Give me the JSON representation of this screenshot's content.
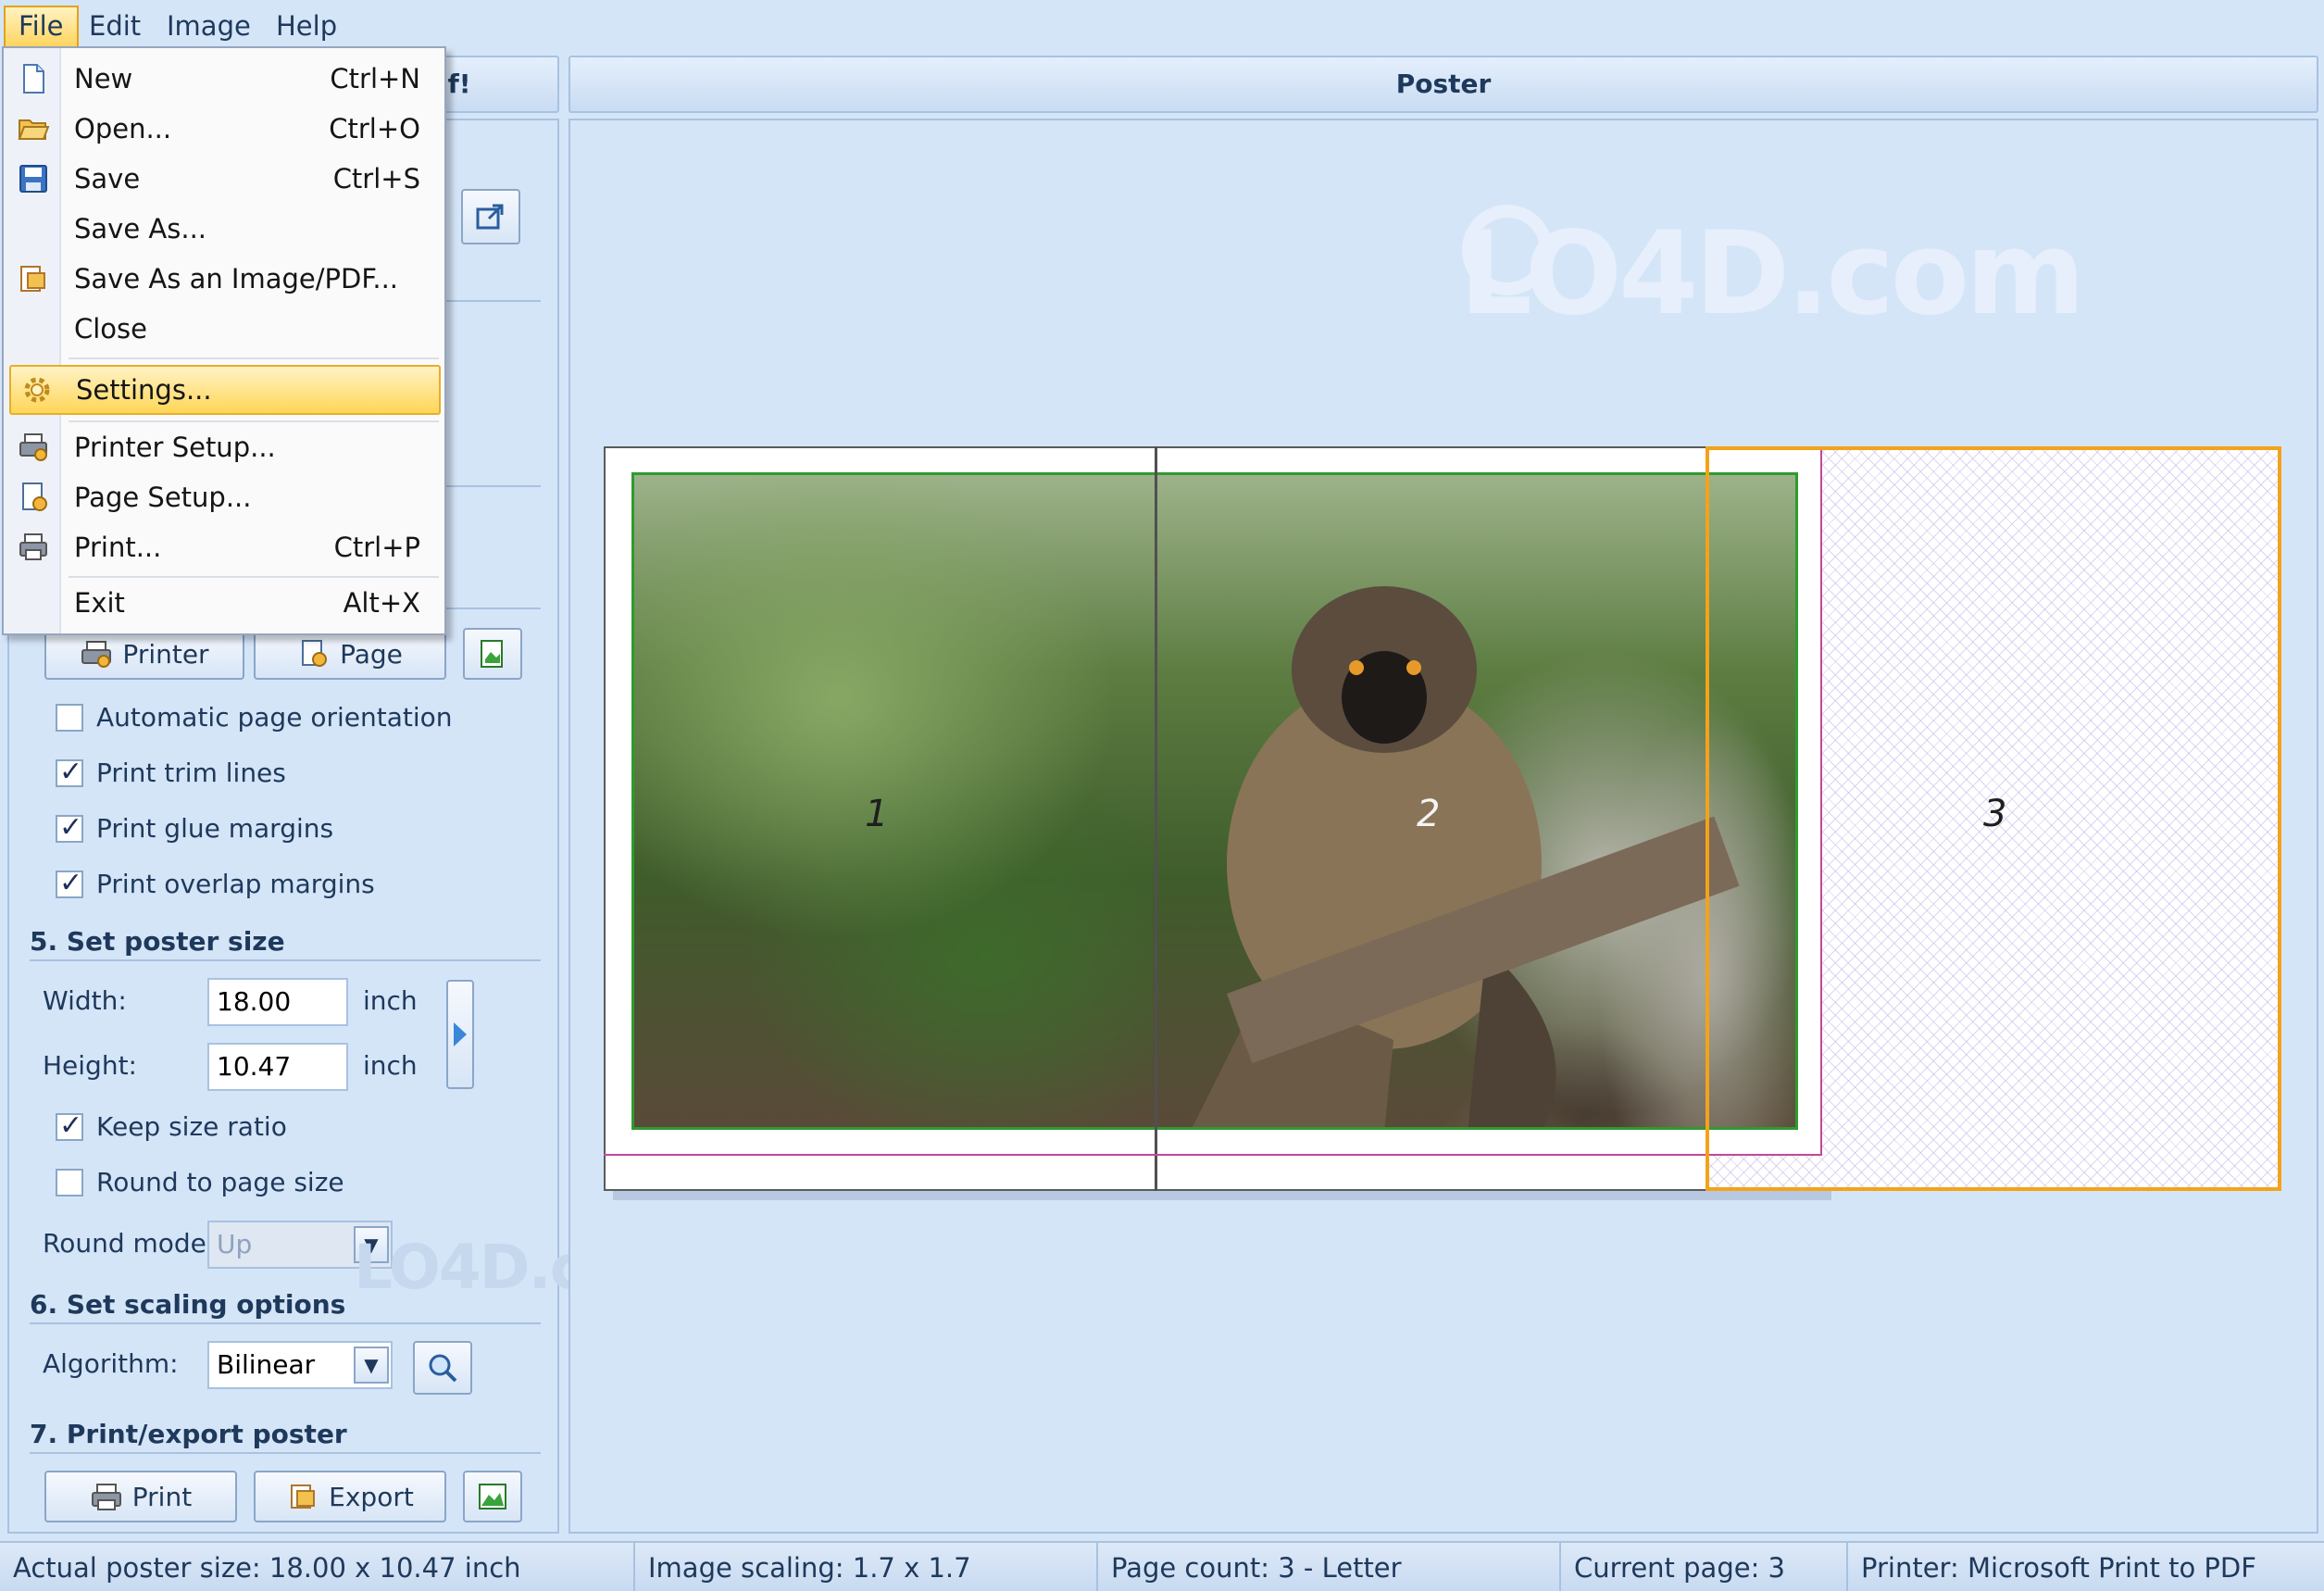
{
  "menubar": {
    "items": [
      "File",
      "Edit",
      "Image",
      "Help"
    ]
  },
  "left_header_partial": "lf!",
  "panel": {
    "poster_title": "Poster"
  },
  "file_menu": {
    "items": [
      {
        "label": "New",
        "shortcut": "Ctrl+N",
        "icon": "new-document-icon"
      },
      {
        "label": "Open...",
        "shortcut": "Ctrl+O",
        "icon": "open-folder-icon"
      },
      {
        "label": "Save",
        "shortcut": "Ctrl+S",
        "icon": "save-icon"
      },
      {
        "label": "Save As...",
        "shortcut": "",
        "icon": ""
      },
      {
        "label": "Save As an Image/PDF...",
        "shortcut": "",
        "icon": "save-image-icon"
      },
      {
        "label": "Close",
        "shortcut": "",
        "icon": ""
      },
      {
        "label": "Settings...",
        "shortcut": "",
        "icon": "gear-icon"
      },
      {
        "label": "Printer Setup...",
        "shortcut": "",
        "icon": "printer-setup-icon"
      },
      {
        "label": "Page Setup...",
        "shortcut": "",
        "icon": "page-setup-icon"
      },
      {
        "label": "Print...",
        "shortcut": "Ctrl+P",
        "icon": "printer-icon"
      },
      {
        "label": "Exit",
        "shortcut": "Alt+X",
        "icon": ""
      }
    ],
    "highlighted": "Settings..."
  },
  "setup_buttons": {
    "printer": "Printer",
    "page": "Page"
  },
  "options": {
    "auto_orientation": {
      "label": "Automatic page orientation",
      "checked": false
    },
    "trim_lines": {
      "label": "Print trim lines",
      "checked": true
    },
    "glue_margins": {
      "label": "Print glue margins",
      "checked": true
    },
    "overlap_margins": {
      "label": "Print overlap margins",
      "checked": true
    }
  },
  "poster_size": {
    "title": "5. Set poster size",
    "width_label": "Width:",
    "width_value": "18.00",
    "height_label": "Height:",
    "height_value": "10.47",
    "unit": "inch",
    "keep_ratio": {
      "label": "Keep size ratio",
      "checked": true
    },
    "round_page": {
      "label": "Round to page size",
      "checked": false
    },
    "round_mode_label": "Round mode:",
    "round_mode_value": "Up"
  },
  "scaling": {
    "title": "6. Set scaling options",
    "algorithm_label": "Algorithm:",
    "algorithm_value": "Bilinear"
  },
  "export": {
    "title": "7. Print/export poster",
    "print_label": "Print",
    "export_label": "Export"
  },
  "preview": {
    "pages": [
      "1",
      "2",
      "3"
    ],
    "current_page": 3
  },
  "watermark": "LO4D.com",
  "status": {
    "actual_size": "Actual poster size: 18.00 x 10.47 inch",
    "scaling": "Image scaling: 1.7 x 1.7",
    "page_count": "Page count: 3 - Letter",
    "current_page": "Current page: 3",
    "printer": "Printer: Microsoft Print to PDF"
  },
  "colors": {
    "background": "#d5e5f8",
    "highlight": "#ffd658",
    "selected_page": "#f2a31b",
    "image_border": "#2f9a2f"
  }
}
